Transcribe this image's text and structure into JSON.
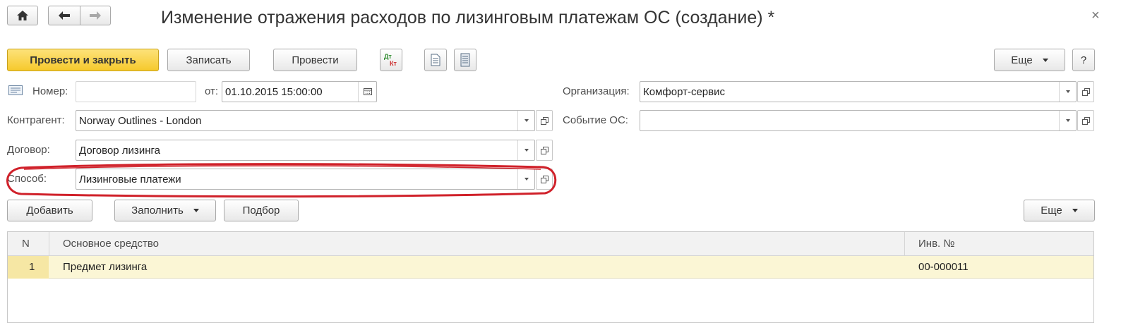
{
  "header": {
    "title": "Изменение отражения расходов по лизинговым платежам ОС (создание) *",
    "close_glyph": "×"
  },
  "toolbar": {
    "post_close_label": "Провести и закрыть",
    "save_label": "Записать",
    "post_label": "Провести",
    "dtkt_top": "Дт",
    "dtkt_bottom": "Кт",
    "more_label": "Еще",
    "help_label": "?"
  },
  "form": {
    "number_label": "Номер:",
    "number_value": "",
    "date_label": "от:",
    "date_value": "01.10.2015 15:00:00",
    "org_label": "Организация:",
    "org_value": "Комфорт-сервис",
    "contractor_label": "Контрагент:",
    "contractor_value": "Norway Outlines - London",
    "event_label": "Событие ОС:",
    "event_value": "",
    "contract_label": "Договор:",
    "contract_value": "Договор лизинга",
    "method_label": "Способ:",
    "method_value": "Лизинговые платежи"
  },
  "table_toolbar": {
    "add_label": "Добавить",
    "fill_label": "Заполнить",
    "select_label": "Подбор",
    "more_label": "Еще"
  },
  "table": {
    "columns": [
      "N",
      "Основное средство",
      "Инв. №"
    ],
    "rows": [
      {
        "n": "1",
        "asset": "Предмет лизинга",
        "inv": "00-000011"
      }
    ]
  },
  "colors": {
    "primary_button": "#f6c92c",
    "highlight_ellipse": "#d0212a",
    "selected_row": "#fbf6d5"
  },
  "icons": [
    "home-icon",
    "back-arrow-icon",
    "forward-arrow-icon",
    "close-icon",
    "dt-kt-icon",
    "document-icon",
    "list-icon",
    "calendar-icon",
    "open-icon",
    "chevron-down-icon"
  ]
}
